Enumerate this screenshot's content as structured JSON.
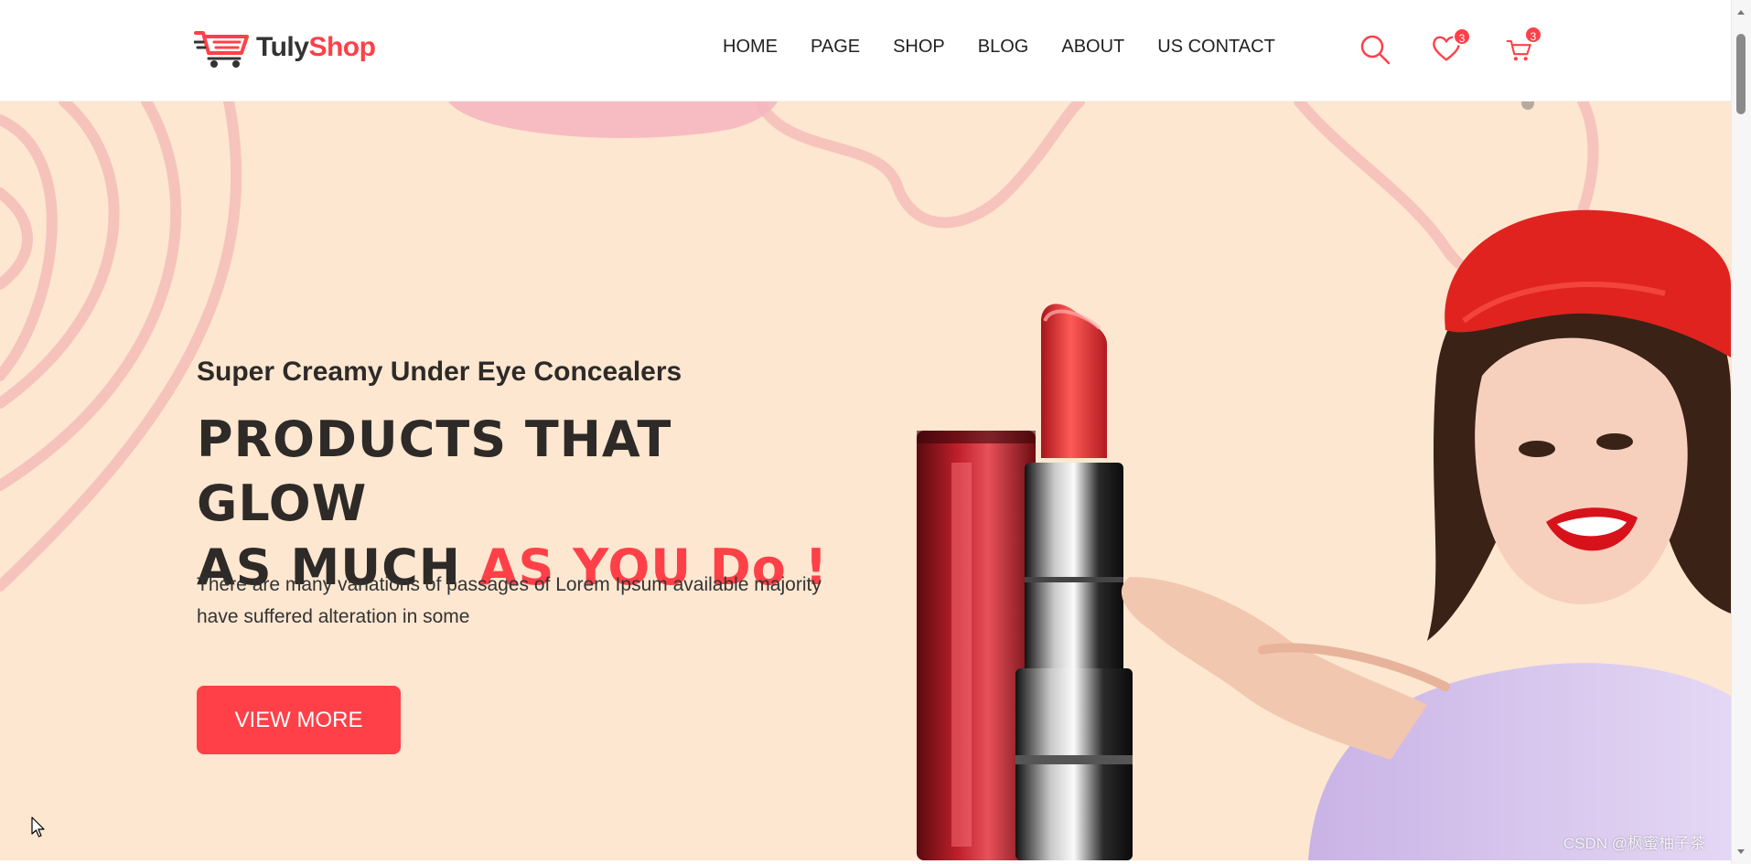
{
  "brand": {
    "name_part1": "Tuly",
    "name_part2": "Shop",
    "primary_color": "#ff4048",
    "text_color": "#333333"
  },
  "nav": {
    "items": [
      {
        "label": "HOME"
      },
      {
        "label": "PAGE"
      },
      {
        "label": "SHOP"
      },
      {
        "label": "BLOG"
      },
      {
        "label": "ABOUT"
      },
      {
        "label": "US CONTACT"
      }
    ]
  },
  "header_icons": {
    "search_icon": "search-icon",
    "wishlist_icon": "heart-icon",
    "wishlist_count": "3",
    "cart_icon": "cart-icon",
    "cart_count": "3"
  },
  "hero": {
    "subtitle": "Super Creamy Under Eye Concealers",
    "title_line1": "PRODUCTS THAT GLOW",
    "title_line2_plain": "AS MUCH ",
    "title_line2_accent": "AS YOU Do !",
    "description": "There are many variations of passages of Lorem Ipsum available majority have suffered alteration in some",
    "button_label": "VIEW MORE",
    "background_color": "#fde7d0",
    "image": "lipstick-and-woman-with-red-beret-pointing"
  },
  "watermark": "CSDN @枫蜜柚子茶"
}
